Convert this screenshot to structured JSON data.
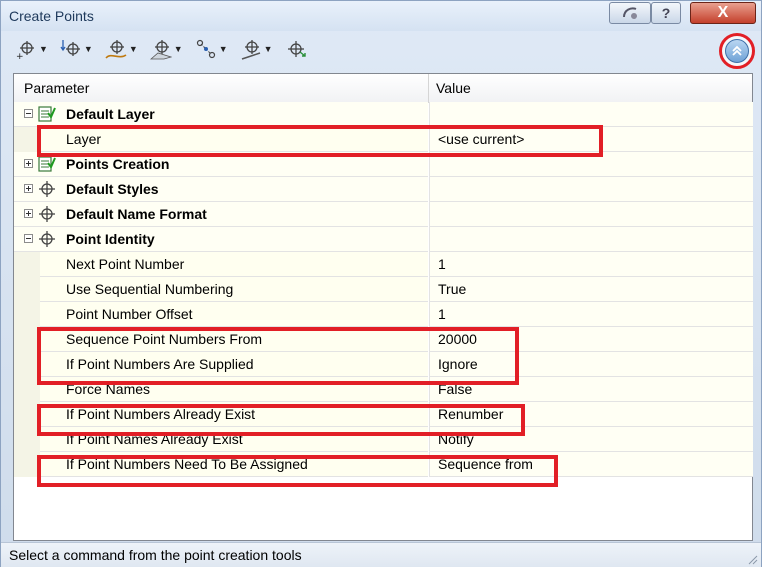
{
  "window": {
    "title": "Create Points"
  },
  "titlebar": {
    "help_label": "?",
    "close_label": "X"
  },
  "toolbar": {
    "tools": [
      {
        "icon": "miscellaneous-points-icon"
      },
      {
        "icon": "elevation-points-icon"
      },
      {
        "icon": "alignment-points-icon"
      },
      {
        "icon": "surface-points-icon"
      },
      {
        "icon": "interpolate-points-icon"
      },
      {
        "icon": "slope-points-icon"
      },
      {
        "icon": "import-points-icon"
      }
    ],
    "collapse_icon": "chevron-double-up-icon"
  },
  "grid": {
    "headers": {
      "parameter": "Parameter",
      "value": "Value"
    },
    "groups": {
      "default_layer": {
        "label": "Default Layer",
        "rows": {
          "layer": {
            "label": "Layer",
            "value": "<use current>"
          }
        }
      },
      "points_creation": {
        "label": "Points Creation"
      },
      "default_styles": {
        "label": "Default Styles"
      },
      "default_name_format": {
        "label": "Default Name Format"
      },
      "point_identity": {
        "label": "Point Identity",
        "rows": {
          "next_point_number": {
            "label": "Next Point Number",
            "value": "1"
          },
          "use_sequential_numbering": {
            "label": "Use Sequential Numbering",
            "value": "True"
          },
          "point_number_offset": {
            "label": "Point Number Offset",
            "value": "1"
          },
          "sequence_point_numbers_from": {
            "label": "Sequence Point Numbers From",
            "value": "20000"
          },
          "if_point_numbers_are_supplied": {
            "label": "If Point Numbers Are Supplied",
            "value": "Ignore"
          },
          "force_names": {
            "label": "Force Names",
            "value": "False"
          },
          "if_point_numbers_already_exist": {
            "label": "If Point Numbers Already Exist",
            "value": "Renumber"
          },
          "if_point_names_already_exist": {
            "label": "If Point Names Already Exist",
            "value": "Notify"
          },
          "if_point_numbers_need_to_be_assigned": {
            "label": "If Point Numbers Need To Be Assigned",
            "value": "Sequence from"
          }
        }
      }
    }
  },
  "status": {
    "text": "Select a command from the point creation tools"
  },
  "colors": {
    "highlight": "#e21f26",
    "row_bg": "#fffff4",
    "accent": "#1e395b"
  }
}
